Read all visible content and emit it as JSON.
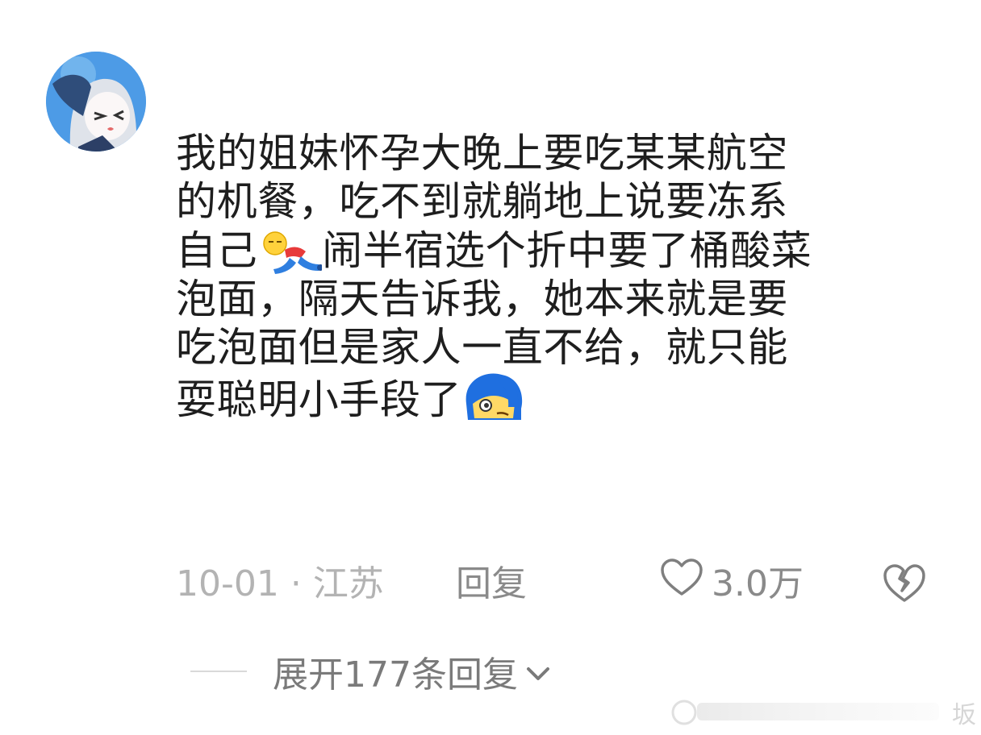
{
  "comment": {
    "lines": [
      "我的姐妹怀孕大晚上要吃某某航空",
      "的机餐，吃不到就躺地上说要冻系",
      "自己",
      "闹半宿选个折中要了桶酸菜",
      "泡面，隔天告诉我，她本来就是要",
      "吃泡面但是家人一直不给，就只能",
      "耍聪明小手段了"
    ],
    "emoji_1": "lying-on-floor-emoji",
    "emoji_2": "blue-hair-smirk-emoji"
  },
  "meta": {
    "date_location": "10-01 · 江苏",
    "reply_label": "回复",
    "like_count": "3.0万"
  },
  "expand": {
    "label": "展开177条回复"
  },
  "watermark": {
    "text": "坂"
  },
  "icons": {
    "avatar": "anime-avatar",
    "like": "heart-outline-icon",
    "dislike": "broken-heart-icon",
    "chevron": "chevron-down-icon"
  },
  "colors": {
    "text": "#1e1e1e",
    "muted": "#8a8a8a",
    "date": "#b3b3b3",
    "avatar_bg": "#4d9be6"
  }
}
